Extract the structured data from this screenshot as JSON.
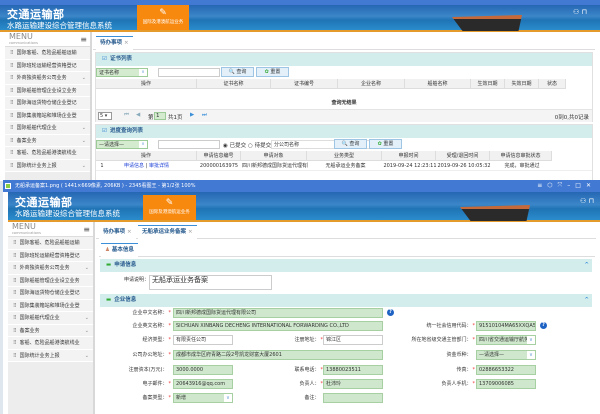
{
  "colors": {
    "header_blue": "#2667b3",
    "nav_orange": "#f7890f",
    "panel_header": "#d3eded",
    "field_green": "#cfe8cd",
    "titlebar": "#4279d2"
  },
  "header": {
    "title": "交通运输部",
    "subtitle": "水路运输建设综合管理信息系统",
    "nav_button": "国际及港澳航运业务",
    "nav_icon": "edit-icon"
  },
  "menu": {
    "title": "MENU",
    "subtitle": "communications"
  },
  "sidebar": {
    "items": [
      {
        "label": "国际客船、危险品船舶运输",
        "chevron": false
      },
      {
        "label": "国际班轮运输经营资格登记",
        "chevron": false
      },
      {
        "label": "外商独资船务公司业务",
        "chevron": true
      },
      {
        "label": "国际船舶管理企业设立业务",
        "chevron": false
      },
      {
        "label": "国际海运货物仓储企业登记",
        "chevron": false
      },
      {
        "label": "国际集装箱站和堆场企业登",
        "chevron": false
      },
      {
        "label": "国际船舶代理企业",
        "chevron": true
      },
      {
        "label": "备案业务",
        "chevron": true
      },
      {
        "label": "客船、危险品船港澳航线业",
        "chevron": false
      },
      {
        "label": "国际统计业务上报",
        "chevron": true
      }
    ]
  },
  "back": {
    "tabs": [
      "待办事项"
    ],
    "cert_panel": {
      "title": "证书列表",
      "select": "证书名称",
      "query": "查询",
      "reset": "重置",
      "columns": [
        "操作",
        "证书名称",
        "证书编号",
        "企业名称",
        "船舶名称",
        "生效日期",
        "失效日期",
        "状态"
      ],
      "empty": "查询无结果",
      "page_size": "5",
      "page_prefix": "第",
      "page": "1",
      "page_suffix": "共1页",
      "count": "0到0,共0记录"
    },
    "progress_panel": {
      "title": "进度查询列表",
      "select": "—请选择—",
      "radio_submitted": "已提交",
      "radio_pending": "待提交",
      "company_placeholder": "分公司名称",
      "query": "查询",
      "reset": "重置",
      "columns": [
        "操作",
        "申请信息编号",
        "申请对象",
        "业务类型",
        "申报时间",
        "受理/退回时间",
        "申请信息审批状态"
      ],
      "rows": [
        {
          "index": "1",
          "link1": "申请信息",
          "sep": "|",
          "link2": "审批详情",
          "id": "200000163975",
          "object": "四川新邦德成国际货运代理有限公司",
          "type": "无船承运业务备案",
          "submitted": "2019-09-24 12:23:11",
          "accepted": "2019-09-26 10:05:32",
          "status": "完成，审批通过"
        }
      ]
    }
  },
  "front": {
    "window_title": "无船承运备案1.png ( 1441×669像素, 206KB ) - 2345看图王 - 第1/2张 100%",
    "tabs": [
      "待办事项",
      "无船承运业务备案"
    ],
    "subtab": "基本信息",
    "apply_section": {
      "title": "申请信息",
      "label": "申请说明：",
      "value": "无船承运业务备案"
    },
    "company_section": {
      "title": "企业信息",
      "fields": {
        "cn_name": {
          "label": "企业中文名称：",
          "value": "四川新邦德成国际货运代理有限公司"
        },
        "en_name": {
          "label": "企业英文名称：",
          "value": "SICHUAN XINBANG DECHENG INTERNATIONAL FORWARDING CO.,LTD"
        },
        "credit_code": {
          "label": "统一社会信用代码：",
          "value": "91510104MA65XXQA5F"
        },
        "econ_type": {
          "label": "经济类型：",
          "value": "有限责任公司"
        },
        "reg_addr": {
          "label": "注册地址：",
          "value": "锦江区"
        },
        "authority": {
          "label": "所在地省级交通主管部门：",
          "value": "四川省交通运输厅航务"
        },
        "office_addr": {
          "label": "公司办公地址：",
          "value": "成都市成华区府青路二段2号凯龙财富大厦2601"
        },
        "currency": {
          "label": "资金币种：",
          "value": "—请选择—"
        },
        "capital": {
          "label": "注册资本(万元)：",
          "value": "3000.0000"
        },
        "phone": {
          "label": "联系电话：",
          "value": "13880023511"
        },
        "fax": {
          "label": "传真：",
          "value": "02886653322"
        },
        "email": {
          "label": "电子邮件：",
          "value": "20643916@qq.com"
        },
        "principal": {
          "label": "负责人：",
          "value": "杜沛玲"
        },
        "principal_mobile": {
          "label": "负责人手机：",
          "value": "13709006085"
        },
        "record_type": {
          "label": "备案类型：",
          "value": "新增"
        },
        "remark": {
          "label": "备注：",
          "value": ""
        }
      }
    }
  }
}
